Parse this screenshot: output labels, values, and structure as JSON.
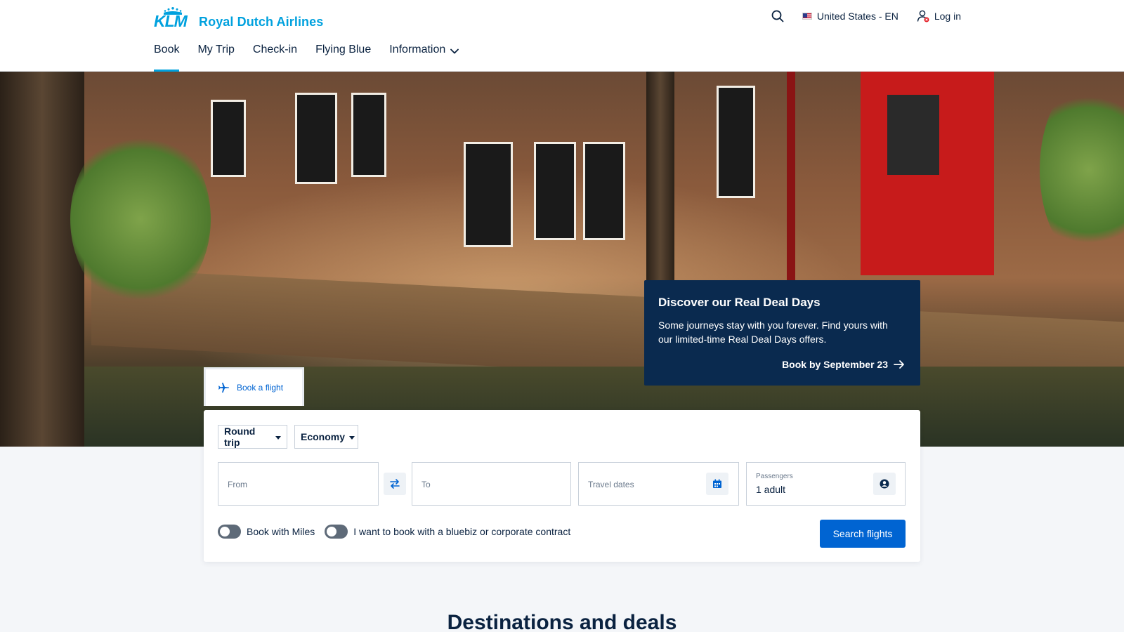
{
  "brand": {
    "logo_text": "KLM",
    "name": "Royal Dutch Airlines"
  },
  "top_actions": {
    "locale": "United States - EN",
    "login": "Log in"
  },
  "nav": {
    "items": [
      {
        "label": "Book",
        "active": true
      },
      {
        "label": "My Trip"
      },
      {
        "label": "Check-in"
      },
      {
        "label": "Flying Blue"
      },
      {
        "label": "Information"
      }
    ]
  },
  "promo": {
    "title": "Discover our Real Deal Days",
    "text": "Some journeys stay with you forever. Find yours with our limited-time Real Deal Days offers.",
    "link": "Book by September 23"
  },
  "booking": {
    "tab_label": "Book a flight",
    "trip_type": "Round trip",
    "cabin": "Economy",
    "from_placeholder": "From",
    "to_placeholder": "To",
    "dates_placeholder": "Travel dates",
    "passengers_label": "Passengers",
    "passengers_value": "1 adult",
    "miles_toggle": "Book with Miles",
    "corporate_toggle": "I want to book with a bluebiz or corporate contract",
    "search_button": "Search flights"
  },
  "sections": {
    "destinations_title": "Destinations and deals"
  },
  "colors": {
    "brand_blue": "#00a1de",
    "navy": "#0a2a4f",
    "action_blue": "#0064d2"
  }
}
